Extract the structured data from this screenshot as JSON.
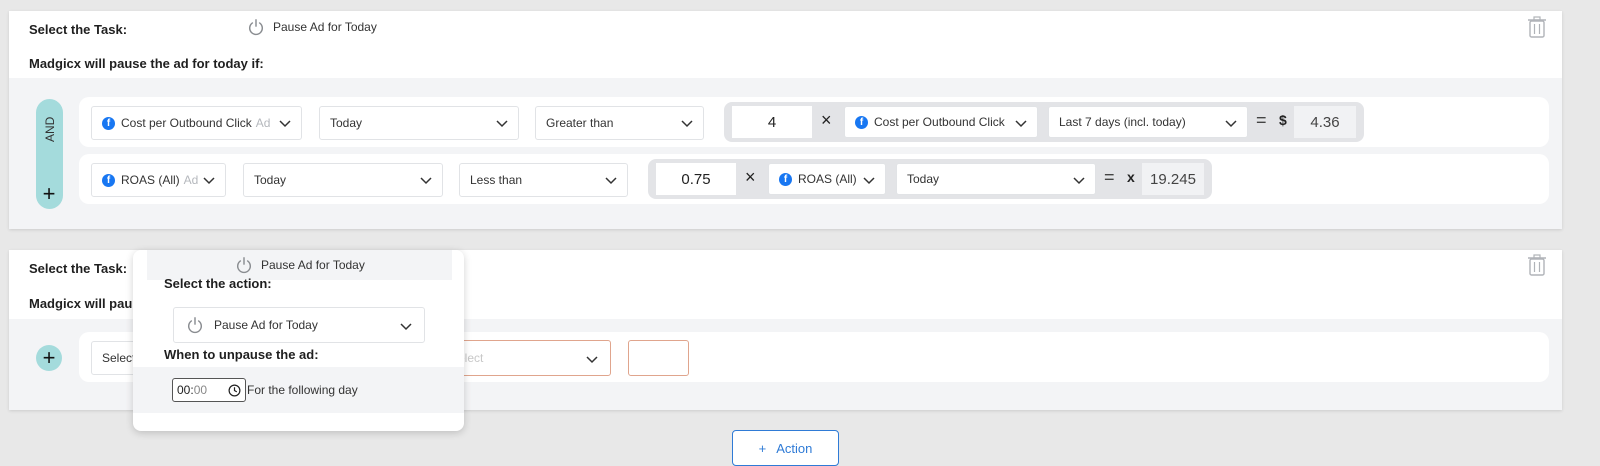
{
  "task1": {
    "select_task_label": "Select the Task:",
    "task_value": "Pause Ad for Today",
    "rule_label": "Madgicx will pause the ad for today if:",
    "operator": "AND",
    "rows": [
      {
        "metric": "Cost per Outbound Click",
        "metric_suffix": "Ad",
        "period": "Today",
        "comparator": "Greater than",
        "multiplier": "4",
        "ref_metric": "Cost per Outbound Click",
        "ref_period": "Last 7 days (incl. today)",
        "equals": "=",
        "unit": "$",
        "result": "4.36"
      },
      {
        "metric": "ROAS (All)",
        "metric_suffix": "Ad",
        "period": "Today",
        "comparator": "Less than",
        "multiplier": "0.75",
        "ref_metric": "ROAS (All)",
        "ref_period": "Today",
        "equals": "=",
        "unit": "x",
        "result": "19.245"
      }
    ]
  },
  "task2": {
    "select_task_label": "Select the Task:",
    "task_value": "Pause Ad for Today",
    "rule_label_partial": "Madgicx will pau",
    "select_placeholder": "Select",
    "comparator_placeholder": "elect"
  },
  "popup": {
    "action_label": "Select the action:",
    "action_value": "Pause Ad for Today",
    "unpause_label": "When to unpause the ad:",
    "time_hh": "00",
    "time_sep": ":",
    "time_mm": "00",
    "following_text": "For the following day"
  },
  "footer": {
    "action_button_plus": "+",
    "action_button_label": "Action"
  },
  "colors": {
    "accent_teal": "#a4dbdc",
    "facebook_blue": "#1877f2",
    "link_blue": "#2f7bd6",
    "error_border": "#e0a58d"
  }
}
